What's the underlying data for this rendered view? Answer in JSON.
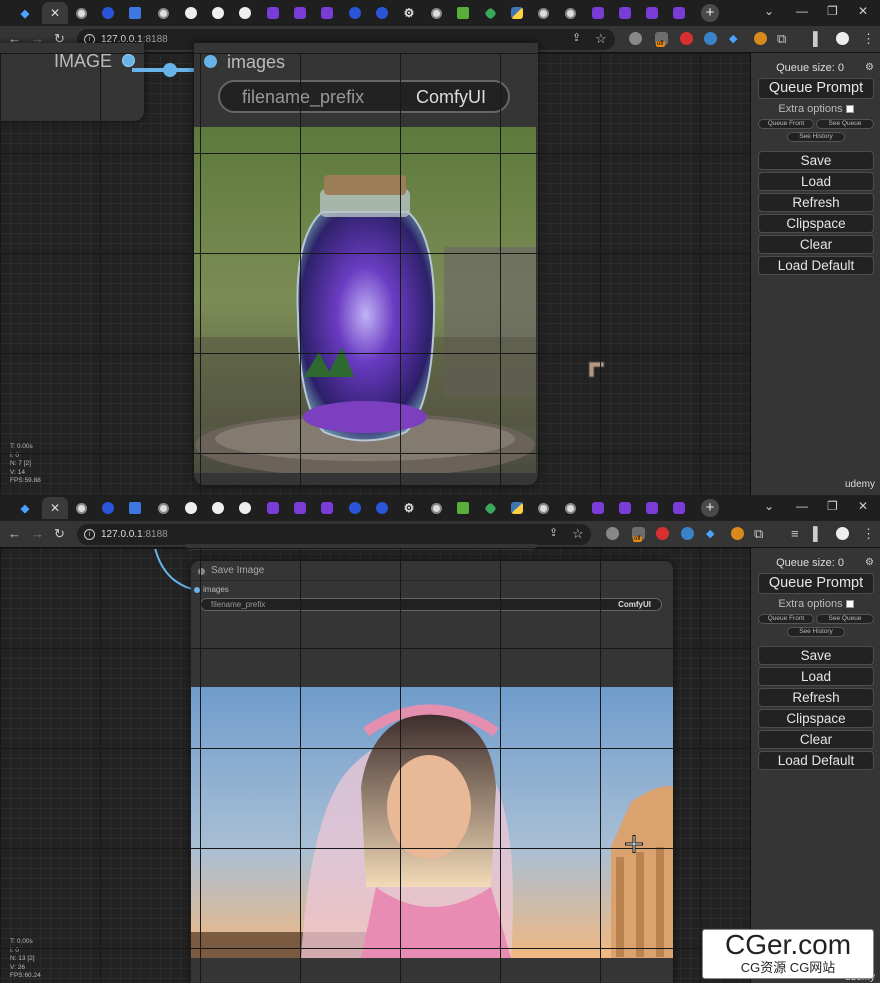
{
  "browser": {
    "url_host": "127.0.0.1",
    "url_port": ":8188",
    "tab_icons": [
      "gem",
      "close",
      "chrome",
      "blue-circle",
      "blue-square",
      "chrome",
      "github",
      "github",
      "github",
      "purple",
      "purple",
      "purple",
      "blue-circle",
      "blue-circle",
      "gear",
      "chrome",
      "green",
      "diamond",
      "python",
      "chrome",
      "chrome",
      "purple",
      "purple",
      "purple",
      "purple"
    ],
    "ext_badge": "off"
  },
  "sidebar": {
    "queue_size_label": "Queue size: 0",
    "queue_prompt": "Queue Prompt",
    "extra_options": "Extra options",
    "queue_front": "Queue Front",
    "see_queue": "See Queue",
    "see_history": "See History",
    "buttons": [
      "Save",
      "Load",
      "Refresh",
      "Clipspace",
      "Clear",
      "Load Default"
    ]
  },
  "top": {
    "output_label": "IMAGE",
    "input_label": "images",
    "widget_name": "filename_prefix",
    "widget_value": "ComfyUI",
    "stats": [
      "T: 0.00s",
      "I: 0",
      "N: 7 [2]",
      "V: 14",
      "FPS:59.88"
    ],
    "watermark_small": "udemy"
  },
  "bottom": {
    "node_title": "Save Image",
    "input_label": "images",
    "widget_name": "filename_prefix",
    "widget_value": "ComfyUI",
    "stats": [
      "T: 0.00s",
      "I: 0",
      "N: 13 [2]",
      "V: 26",
      "FPS:60.24"
    ],
    "watermark_small": "udemy"
  },
  "watermark": {
    "main": "CGer.com",
    "sub": "CG资源 CG网站"
  },
  "colors": {
    "link": "#68b4e8",
    "node_bg": "#353535",
    "sidebar_bg": "#353535"
  }
}
